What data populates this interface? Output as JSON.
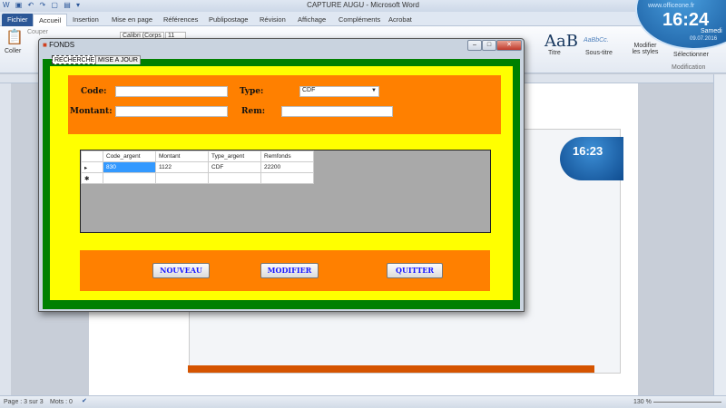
{
  "word": {
    "title": "CAPTURE AUGU - Microsoft Word",
    "tabs": [
      "Fichier",
      "Accueil",
      "Insertion",
      "Mise en page",
      "Références",
      "Publipostage",
      "Révision",
      "Affichage",
      "Compléments",
      "Acrobat"
    ],
    "ribbon": {
      "coller": "Coller",
      "couper": "Couper",
      "font": "Calibri (Corps",
      "size": "11",
      "style_titre": "Titre",
      "style_soustitre": "Sous-titre",
      "modifier_styles": "Modifier les styles",
      "selectionner": "Sélectionner",
      "modification": "Modification",
      "aab": "AaB",
      "aabbcc": "AaBbCc."
    },
    "clock": {
      "site": "www.officeone.fr",
      "time": "16:24",
      "day": "Samedi",
      "date": "09.07.2016"
    },
    "status": {
      "page": "Page : 3 sur 3",
      "mots": "Mots : 0",
      "zoom": "130 %"
    }
  },
  "inner_clock": {
    "time": "16:23"
  },
  "dialog": {
    "title": "FONDS",
    "tabs": [
      "RECHERCHE",
      "MISE A JOUR"
    ],
    "labels": {
      "code": "Code:",
      "type": "Type:",
      "montant": "Montant:",
      "rem": "Rem:"
    },
    "fields": {
      "code": "",
      "type": "CDF",
      "montant": "",
      "rem": ""
    },
    "grid": {
      "columns": [
        "Code_argent",
        "Montant",
        "Type_argent",
        "Remfonds"
      ],
      "rows": [
        [
          "830",
          "1122",
          "CDF",
          "22200"
        ]
      ]
    },
    "buttons": {
      "nouveau": "NOUVEAU",
      "modifier": "MODIFIER",
      "quitter": "QUITTER"
    }
  }
}
